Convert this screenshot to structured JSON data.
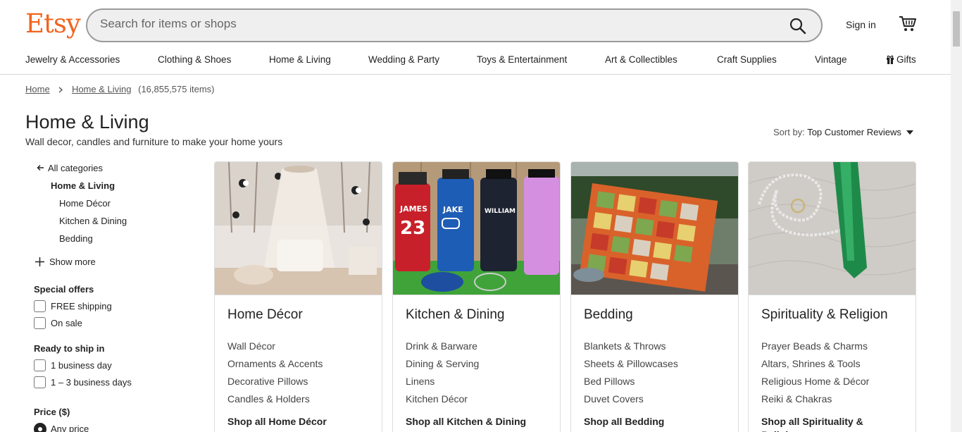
{
  "header": {
    "logo": "Etsy",
    "search_placeholder": "Search for items or shops",
    "sign_in": "Sign in"
  },
  "nav": {
    "items": [
      "Jewelry & Accessories",
      "Clothing & Shoes",
      "Home & Living",
      "Wedding & Party",
      "Toys & Entertainment",
      "Art & Collectibles",
      "Craft Supplies",
      "Vintage",
      "Gifts"
    ]
  },
  "breadcrumb": {
    "home": "Home",
    "current": "Home & Living",
    "count": "(16,855,575 items)"
  },
  "page": {
    "title": "Home & Living",
    "subtitle": "Wall decor, candles and furniture to make your home yours",
    "sort_label": "Sort by:",
    "sort_value": "Top Customer Reviews"
  },
  "sidebar": {
    "all_categories": "All categories",
    "current": "Home & Living",
    "subcategories": [
      "Home Décor",
      "Kitchen & Dining",
      "Bedding"
    ],
    "show_more": "Show more",
    "special_offers": {
      "heading": "Special offers",
      "options": [
        "FREE shipping",
        "On sale"
      ]
    },
    "ready_to_ship": {
      "heading": "Ready to ship in",
      "options": [
        "1 business day",
        "1 – 3 business days"
      ]
    },
    "price": {
      "heading": "Price ($)",
      "selected": "Any price"
    }
  },
  "cards": [
    {
      "title": "Home Décor",
      "links": [
        "Wall Décor",
        "Ornaments & Accents",
        "Decorative Pillows",
        "Candles & Holders"
      ],
      "shop_all": "Shop all Home Décor"
    },
    {
      "title": "Kitchen & Dining",
      "links": [
        "Drink & Barware",
        "Dining & Serving",
        "Linens",
        "Kitchen Décor"
      ],
      "shop_all": "Shop all Kitchen & Dining",
      "bottle_labels": [
        "JAMES",
        "23",
        "JAKE",
        "WILLIAM"
      ]
    },
    {
      "title": "Bedding",
      "links": [
        "Blankets & Throws",
        "Sheets & Pillowcases",
        "Bed Pillows",
        "Duvet Covers"
      ],
      "shop_all": "Shop all Bedding"
    },
    {
      "title": "Spirituality & Religion",
      "links": [
        "Prayer Beads & Charms",
        "Altars, Shrines & Tools",
        "Religious Home & Décor",
        "Reiki & Chakras"
      ],
      "shop_all": "Shop all Spirituality & Religion"
    }
  ],
  "colors": {
    "brand": "#f1641e",
    "text": "#222222"
  }
}
